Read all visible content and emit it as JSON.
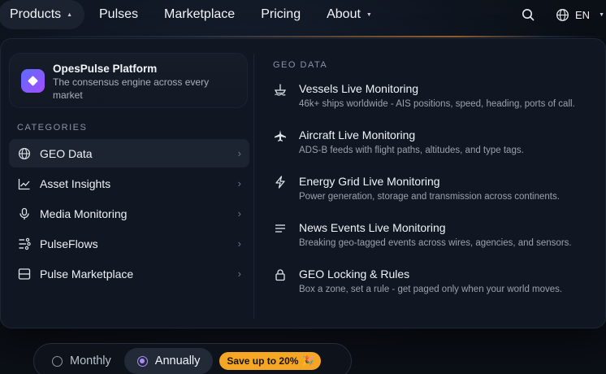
{
  "nav": {
    "products": "Products",
    "pulses": "Pulses",
    "marketplace": "Marketplace",
    "pricing": "Pricing",
    "about": "About",
    "language": "EN"
  },
  "platform": {
    "title": "OpesPulse Platform",
    "description": "The consensus engine across every market"
  },
  "categories": {
    "heading": "CATEGORIES",
    "items": [
      {
        "label": "GEO Data",
        "icon": "globe-icon",
        "active": true
      },
      {
        "label": "Asset Insights",
        "icon": "chart-line-icon",
        "active": false
      },
      {
        "label": "Media Monitoring",
        "icon": "microphone-icon",
        "active": false
      },
      {
        "label": "PulseFlows",
        "icon": "flows-icon",
        "active": false
      },
      {
        "label": "Pulse Marketplace",
        "icon": "marketplace-icon",
        "active": false
      }
    ]
  },
  "geo": {
    "heading": "GEO DATA",
    "items": [
      {
        "title": "Vessels Live Monitoring",
        "desc": "46k+ ships worldwide - AIS positions, speed, heading, ports of call.",
        "icon": "ship-icon"
      },
      {
        "title": "Aircraft Live Monitoring",
        "desc": "ADS-B feeds with flight paths, altitudes, and type tags.",
        "icon": "airplane-icon"
      },
      {
        "title": "Energy Grid Live Monitoring",
        "desc": "Power generation, storage and transmission across continents.",
        "icon": "lightning-icon"
      },
      {
        "title": "News Events Live Monitoring",
        "desc": "Breaking geo-tagged events across wires, agencies, and sensors.",
        "icon": "news-lines-icon"
      },
      {
        "title": "GEO Locking & Rules",
        "desc": "Box a zone, set a rule - get paged only when your world moves.",
        "icon": "lock-icon"
      }
    ]
  },
  "billing": {
    "monthly": "Monthly",
    "annually": "Annually",
    "selected": "Annually",
    "save_badge": "Save up to 20%"
  },
  "colors": {
    "background": "#0b0f16",
    "menu_bg": "#111722",
    "accent": "#a98cff",
    "badge": "#f5a623"
  }
}
